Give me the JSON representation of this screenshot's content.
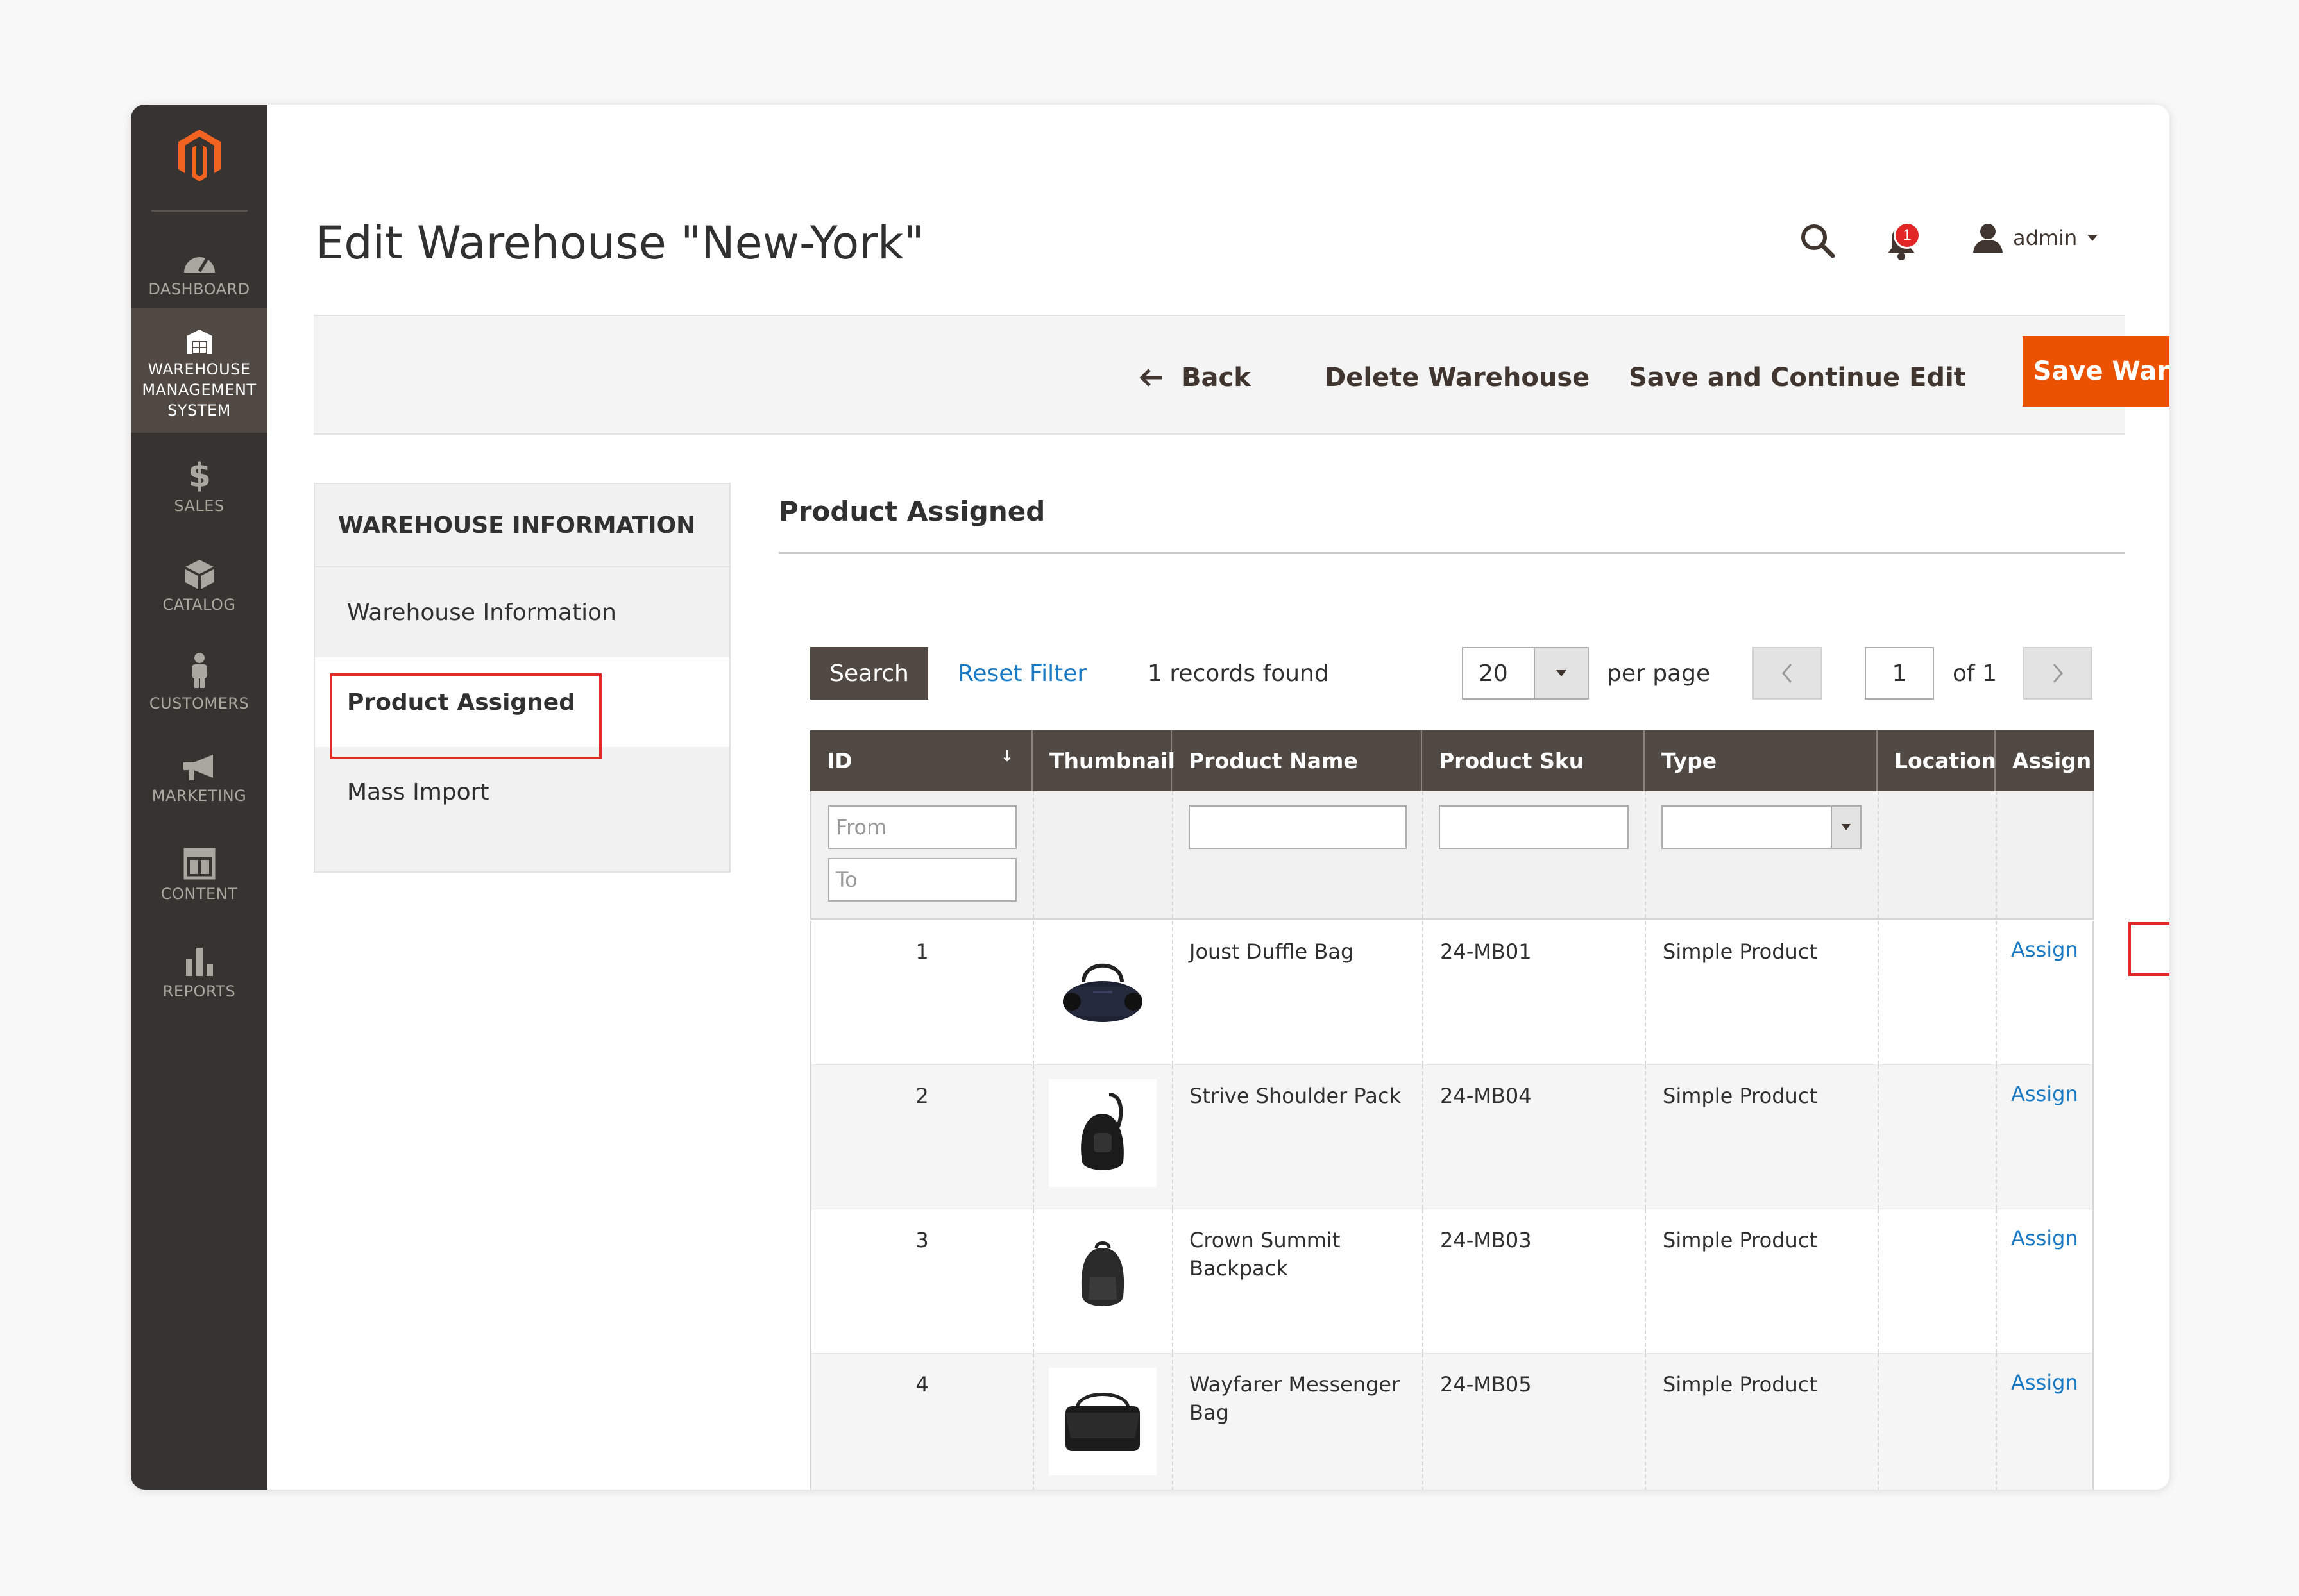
{
  "sidebar": {
    "logo": "magento-logo",
    "items": [
      {
        "label": "DASHBOARD",
        "icon": "dashboard-icon",
        "active": false
      },
      {
        "label": "WAREHOUSE\nMANAGEMENT\nSYSTEM",
        "icon": "warehouse-icon",
        "active": true
      },
      {
        "label": "SALES",
        "icon": "dollar-icon",
        "active": false
      },
      {
        "label": "CATALOG",
        "icon": "cube-icon",
        "active": false
      },
      {
        "label": "CUSTOMERS",
        "icon": "person-icon",
        "active": false
      },
      {
        "label": "MARKETING",
        "icon": "megaphone-icon",
        "active": false
      },
      {
        "label": "CONTENT",
        "icon": "layout-icon",
        "active": false
      },
      {
        "label": "REPORTS",
        "icon": "bar-chart-icon",
        "active": false
      }
    ]
  },
  "header": {
    "title": "Edit Warehouse \"New-York\"",
    "notification_count": "1",
    "user": "admin"
  },
  "actions": {
    "back": "Back",
    "delete": "Delete Warehouse",
    "save_continue": "Save and Continue Edit",
    "save": "Save Warehouse"
  },
  "tabs": {
    "heading": "WAREHOUSE INFORMATION",
    "items": [
      "Warehouse Information",
      "Product Assigned",
      "Mass Import"
    ],
    "active": "Product Assigned"
  },
  "section": {
    "title": "Product Assigned"
  },
  "grid_toolbar": {
    "search": "Search",
    "reset": "Reset Filter",
    "records": "1 records found",
    "per_page_value": "20",
    "per_page_label": "per page",
    "page": "1",
    "of": "of 1"
  },
  "grid": {
    "columns": [
      "ID",
      "Thumbnail",
      "Product Name",
      "Product Sku",
      "Type",
      "Location",
      "Assign"
    ],
    "filters": {
      "from_placeholder": "From",
      "to_placeholder": "To"
    },
    "rows": [
      {
        "id": "1",
        "name": "Joust Duffle Bag",
        "sku": "24-MB01",
        "type": "Simple Product",
        "location": "",
        "assign": "Assign",
        "thumb": "duffle-bag-image"
      },
      {
        "id": "2",
        "name": "Strive Shoulder Pack",
        "sku": "24-MB04",
        "type": "Simple Product",
        "location": "",
        "assign": "Assign",
        "thumb": "shoulder-pack-image"
      },
      {
        "id": "3",
        "name": "Crown Summit Backpack",
        "sku": "24-MB03",
        "type": "Simple Product",
        "location": "",
        "assign": "Assign",
        "thumb": "backpack-image"
      },
      {
        "id": "4",
        "name": "Wayfarer Messenger Bag",
        "sku": "24-MB05",
        "type": "Simple Product",
        "location": "",
        "assign": "Assign",
        "thumb": "messenger-bag-image"
      }
    ]
  },
  "colors": {
    "accent": "#eb5202",
    "sidebar": "#373330",
    "grid_header": "#514943",
    "link": "#1979c3",
    "highlight": "#e02b27"
  }
}
